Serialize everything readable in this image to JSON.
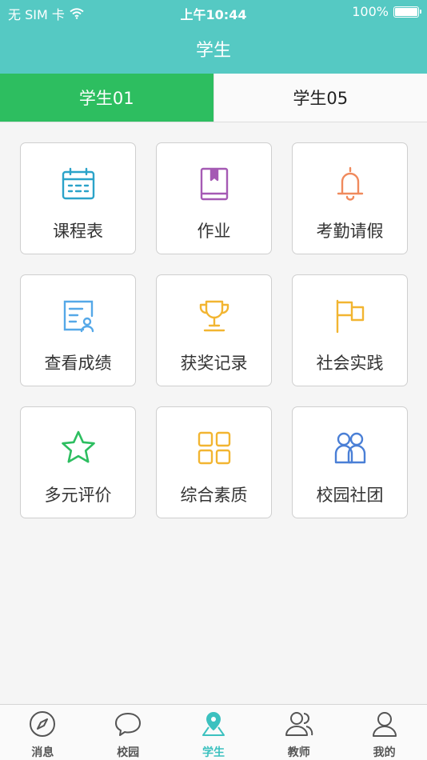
{
  "status": {
    "carrier": "无 SIM 卡",
    "time": "上午10:44",
    "battery": "100%"
  },
  "header": {
    "title": "学生"
  },
  "tabs": [
    {
      "label": "学生01",
      "active": true
    },
    {
      "label": "学生05",
      "active": false
    }
  ],
  "features": [
    {
      "label": "课程表",
      "icon": "calendar-icon",
      "color": "#2ba3c9"
    },
    {
      "label": "作业",
      "icon": "book-icon",
      "color": "#a55ab4"
    },
    {
      "label": "考勤请假",
      "icon": "bell-icon",
      "color": "#f08a5d"
    },
    {
      "label": "查看成绩",
      "icon": "report-card-icon",
      "color": "#55a8e8"
    },
    {
      "label": "获奖记录",
      "icon": "trophy-icon",
      "color": "#f2b531"
    },
    {
      "label": "社会实践",
      "icon": "flag-icon",
      "color": "#f2b531"
    },
    {
      "label": "多元评价",
      "icon": "star-icon",
      "color": "#2dbe60"
    },
    {
      "label": "综合素质",
      "icon": "grid-icon",
      "color": "#f2b531"
    },
    {
      "label": "校园社团",
      "icon": "group-icon",
      "color": "#4a7fd6"
    }
  ],
  "tabbar": [
    {
      "label": "消息",
      "icon": "compass-icon",
      "active": false
    },
    {
      "label": "校园",
      "icon": "chat-bubble-icon",
      "active": false
    },
    {
      "label": "学生",
      "icon": "location-pin-icon",
      "active": true
    },
    {
      "label": "教师",
      "icon": "people-icon",
      "active": false
    },
    {
      "label": "我的",
      "icon": "person-icon",
      "active": false
    }
  ],
  "colors": {
    "header": "#55c9c3",
    "tab_active": "#2dbe60",
    "tabbar_active": "#3cc1bf"
  }
}
